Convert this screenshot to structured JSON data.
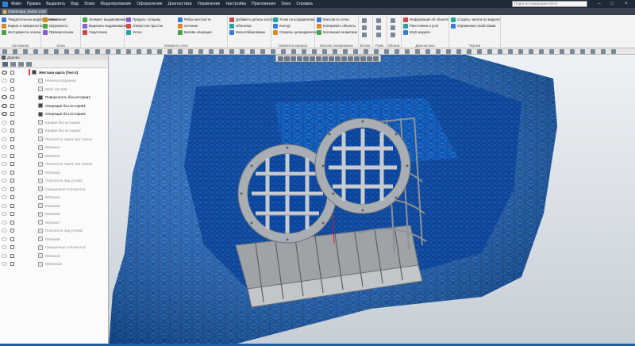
{
  "menubar": {
    "items": [
      "Файл",
      "Правка",
      "Выделить",
      "Вид",
      "Эскиз",
      "Моделирование",
      "Оформление",
      "Диагностика",
      "Управление",
      "Настройка",
      "Приложения",
      "Окно",
      "Справка"
    ],
    "search_placeholder": "Поиск по командам (Alt+/)"
  },
  "tab": {
    "title": "zhestmaya_karta1.m3d"
  },
  "ribbon": {
    "groups": [
      {
        "label": "Системная",
        "buttons": [
          "Твердотельное моделирование",
          "Каркас и поверхности",
          "Инструменты эскиза"
        ]
      },
      {
        "label": "Эскиз",
        "buttons": [
          "Автолиния",
          "Окружность",
          "Прямоугольник"
        ]
      },
      {
        "label": "",
        "buttons": [
          "Элемент выдавливания",
          "Вырезать выдавливанием",
          "Скругление"
        ]
      },
      {
        "label": "Элементы тела",
        "buttons": [
          "Придать толщину",
          "Отверстие простое",
          "Уклон",
          "Ребро жесткости",
          "Сечение",
          "Булева операция"
        ]
      },
      {
        "label": "",
        "buttons": [
          "Добавить деталь-заготовку",
          "Оболочка",
          "Масштабирование"
        ]
      },
      {
        "label": "Элементы каркаса",
        "buttons": [
          "Точка по координатам",
          "Контур",
          "Спираль цилиндрическая"
        ]
      },
      {
        "label": "Массив, копирование",
        "buttons": [
          "Массив по сетке",
          "Копировать объекты",
          "Коллекция геометрии"
        ]
      },
      {
        "label": "Вспом.",
        "buttons": []
      },
      {
        "label": "Разм.",
        "buttons": []
      },
      {
        "label": "Обозна.",
        "buttons": []
      },
      {
        "label": "Диагностика",
        "buttons": [
          "Информация об объекте",
          "Расстояние и угол",
          "МЦХ модели"
        ]
      },
      {
        "label": "Чертеж",
        "buttons": [
          "Создать чертеж по модели",
          "Управление свойствами"
        ]
      }
    ]
  },
  "tree": {
    "panel_title": "Дерево",
    "rows": [
      {
        "label": "Жёсткая карта (Тел-2)",
        "eye": true
      },
      {
        "label": "Начало координат",
        "eye": false
      },
      {
        "label": "stkof_tst.m3d",
        "eye": false
      },
      {
        "label": "Поверхность без истории2",
        "eye": true
      },
      {
        "label": "Операция без истории1",
        "eye": true
      },
      {
        "label": "Операция без истории2",
        "eye": true
      },
      {
        "label": "Кривая без истории1",
        "eye": false
      },
      {
        "label": "Кривая без истории2",
        "eye": false
      },
      {
        "label": "Плоскость через три точки1",
        "eye": false
      },
      {
        "label": "МЭскиз1",
        "eye": false
      },
      {
        "label": "МЭскиз2",
        "eye": false
      },
      {
        "label": "Плоскость через три точки2",
        "eye": false
      },
      {
        "label": "МЭскиз3",
        "eye": false
      },
      {
        "label": "Плоскость под углом1",
        "eye": false
      },
      {
        "label": "Смещенная плоскость1",
        "eye": false
      },
      {
        "label": "МЭскиз4",
        "eye": false
      },
      {
        "label": "МЭскиз5",
        "eye": false
      },
      {
        "label": "МЭскиз6",
        "eye": false
      },
      {
        "label": "МЭскиз7",
        "eye": false
      },
      {
        "label": "Плоскость под углом2",
        "eye": false
      },
      {
        "label": "МЭскиз8",
        "eye": false
      },
      {
        "label": "Смещенная плоскость2",
        "eye": false
      },
      {
        "label": "МЭскиз9",
        "eye": false
      },
      {
        "label": "МЭскиз10",
        "eye": false
      }
    ]
  },
  "colors": {
    "mesh_blue": "#1466c8",
    "mesh_dark": "#0a3a8a",
    "part_gray": "#a8adb3",
    "menubar": "#1f2a38"
  }
}
